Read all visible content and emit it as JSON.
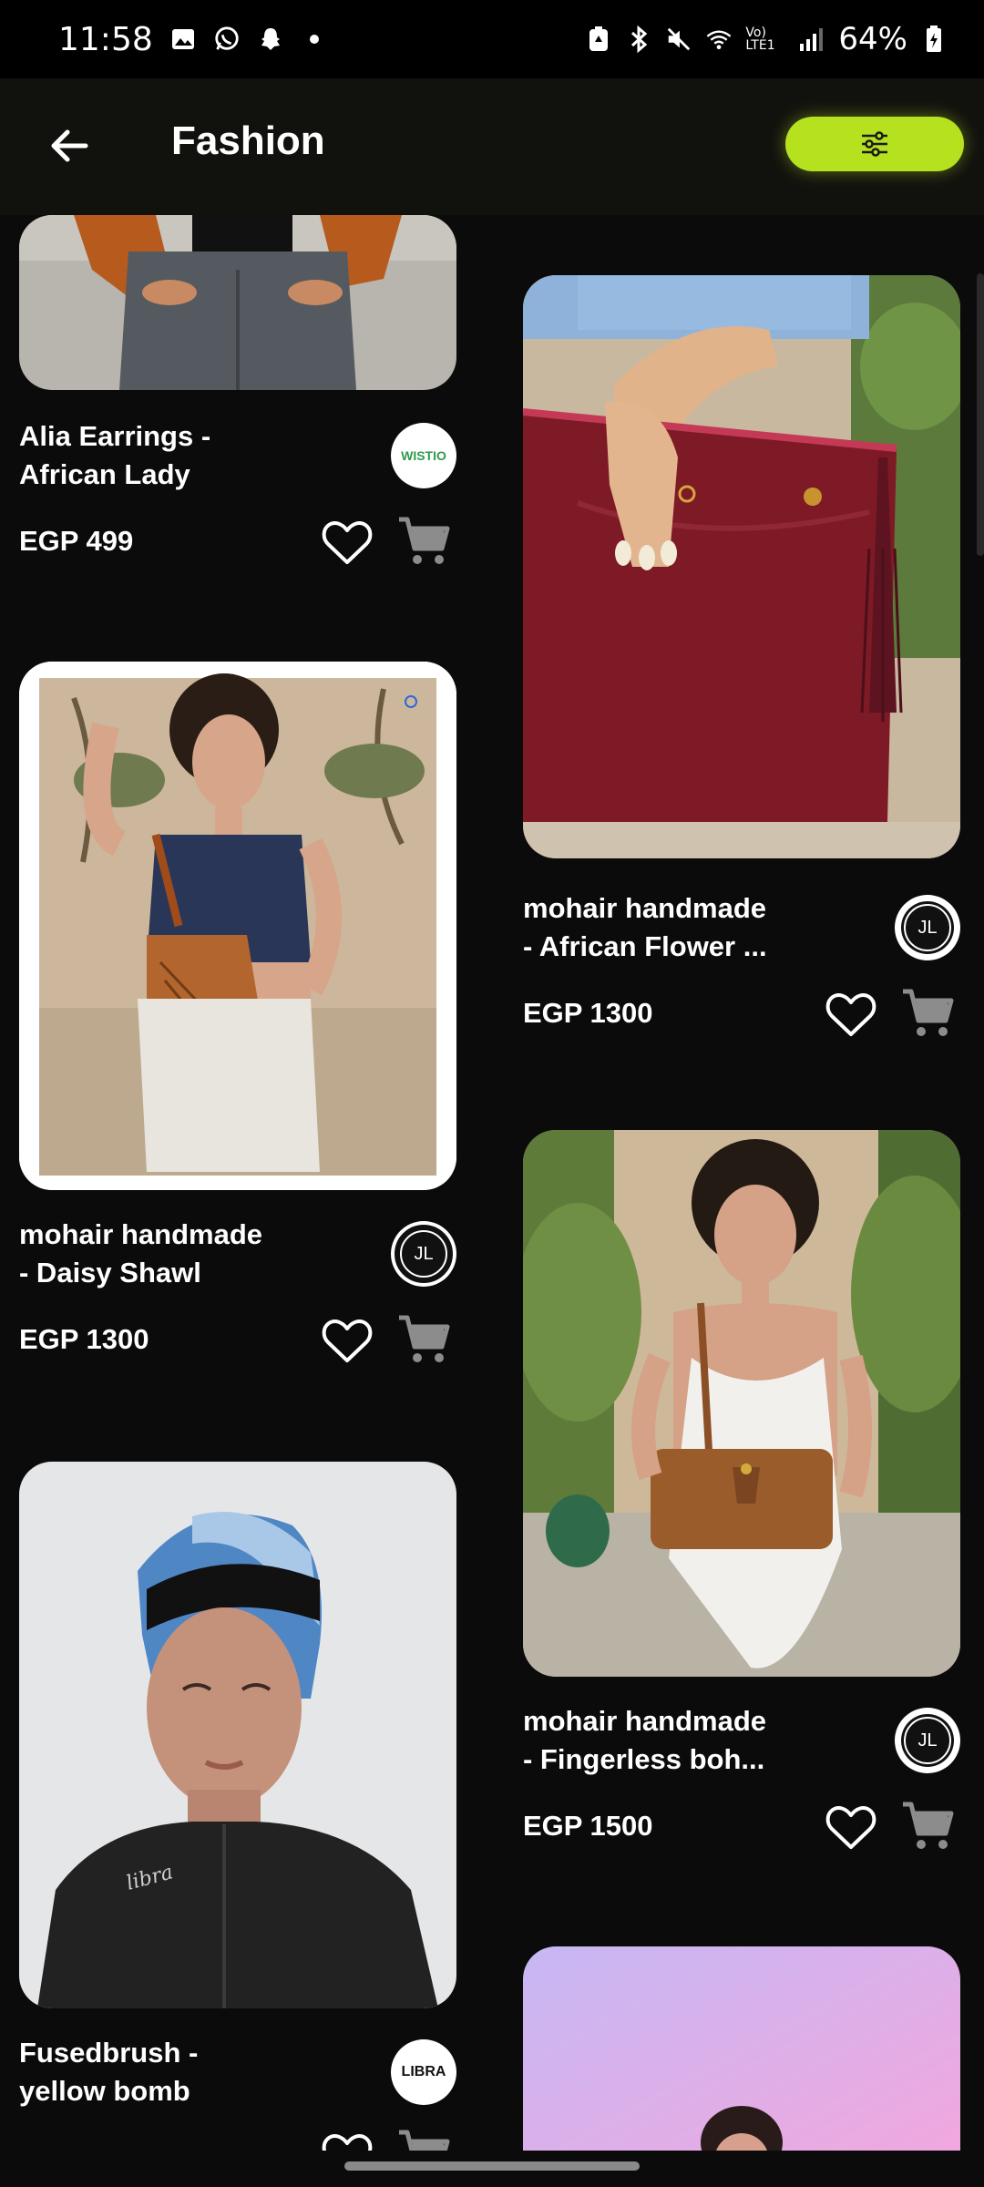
{
  "status": {
    "time": "11:58",
    "battery": "64%",
    "lte_label": "Vo) LTE1"
  },
  "header": {
    "title": "Fashion"
  },
  "products": [
    {
      "name_line1": "Alia Earrings -",
      "name_line2": "African Lady",
      "price": "EGP 499",
      "brand": "WISTIO"
    },
    {
      "name_line1": "mohair handmade",
      "name_line2": "- Daisy Shawl",
      "price": "EGP 1300",
      "brand": "JL"
    },
    {
      "name_line1": "Fusedbrush  -",
      "name_line2": "yellow bomb",
      "price": "",
      "brand": "LIBRA"
    },
    {
      "name_line1": "mohair handmade",
      "name_line2": "- African Flower ...",
      "price": "EGP 1300",
      "brand": "JL"
    },
    {
      "name_line1": "mohair handmade",
      "name_line2": "- Fingerless boh...",
      "price": "EGP 1500",
      "brand": "JL"
    }
  ],
  "colors": {
    "accent": "#b6e11f",
    "background": "#0b0b0b",
    "header": "#11120e"
  },
  "icons": {
    "back": "arrow-left-icon",
    "filter": "sliders-icon",
    "favorite": "heart-outline-icon",
    "cart": "cart-icon"
  }
}
